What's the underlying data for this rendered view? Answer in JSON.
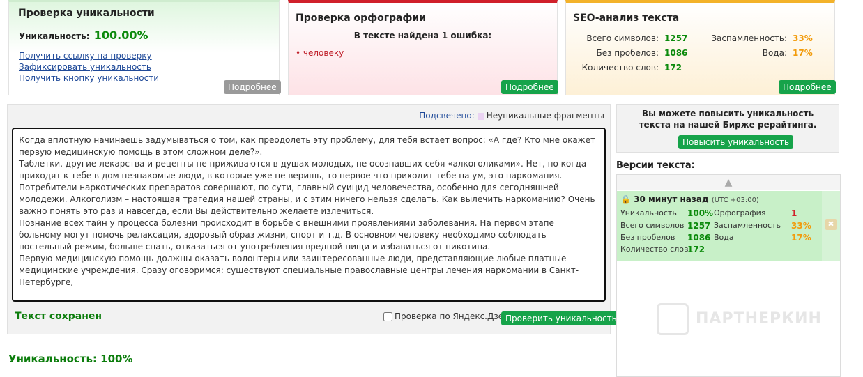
{
  "uniqueness_panel": {
    "title": "Проверка уникальности",
    "label": "Уникальность:",
    "value": "100.00%",
    "links": [
      "Получить ссылку на проверку",
      "Зафиксировать уникальность",
      "Получить кнопку уникальности"
    ],
    "more": "Подробнее"
  },
  "spelling_panel": {
    "title": "Проверка орфографии",
    "found": "В тексте найдена 1 ошибка:",
    "word": "• человеку",
    "more": "Подробнее"
  },
  "seo_panel": {
    "title": "SEO-анализ текста",
    "total_chars_label": "Всего символов:",
    "total_chars": "1257",
    "no_spaces_label": "Без пробелов:",
    "no_spaces": "1086",
    "words_label": "Количество слов:",
    "words": "172",
    "spam_label": "Заспамленность:",
    "spam": "33%",
    "water_label": "Вода:",
    "water": "17%",
    "more": "Подробнее"
  },
  "editor": {
    "highlighted_label": "Подсвечено:",
    "nonunique_label": "Неуникальные фрагменты",
    "paragraphs": [
      "Когда вплотную начинаешь задумываться о том, как преодолеть эту проблему, для тебя встает вопрос: «А где? Кто мне окажет первую медицинскую помощь в этом сложном деле?».",
      "Таблетки, другие лекарства и рецепты не приживаются в душах молодых, не осознавших себя «алкоголиками». Нет, но когда приходят к тебе в дом незнакомые люди, в которые уже не веришь, то первое что приходит тебе на ум, это наркомания. Потребители наркотических препаратов совершают, по сути, главный суицид человечества, особенно для сегодняшней молодежи. Алкоголизм – настоящая трагедия нашей страны, и с этим ничего нельзя сделать. Как вылечить наркоманию? Очень важно понять это раз и навсегда, если Вы действительно желаете излечиться.",
      "Познание всех тайн у процесса болезни происходит в борьбе с внешними проявлениями заболевания. На первом этапе больному могут помочь релаксация, здоровый образ жизни, спорт и т.д. В основном человеку необходимо соблюдать постельный режим, больше спать, отказаться от употребления вредной пищи и избавиться от никотина.",
      "Первую медицинскую помощь должны оказать волонтеры или заинтересованные люди, представляющие любые платные медицинские учреждения. Сразу оговоримся: существуют специальные православные центры лечения наркомании в Санкт-Петербурге,"
    ],
    "saved": "Текст сохранен",
    "dzen_label": "Проверка по Яндекс.Дзен",
    "check_button": "Проверить уникальность"
  },
  "bottom_uniqueness": "Уникальность: 100%",
  "birzha": {
    "text": "Вы можете повысить уникальность текста на нашей Бирже рерайтинга.",
    "button": "Повысить уникальность"
  },
  "versions": {
    "title": "Версии текста:",
    "item": {
      "time": "30 минут назад",
      "tz": "(UTC +03:00)",
      "uniq_label": "Уникальность",
      "uniq": "100%",
      "chars_label": "Всего символов",
      "chars": "1257",
      "nospace_label": "Без пробелов",
      "nospace": "1086",
      "words_label": "Количество слов",
      "words": "172",
      "spell_label": "Орфография",
      "spell": "1",
      "spam_label": "Заспамленность",
      "spam": "33%",
      "water_label": "Вода",
      "water": "17%"
    }
  },
  "watermark": "ПАРТНЕРКИН"
}
